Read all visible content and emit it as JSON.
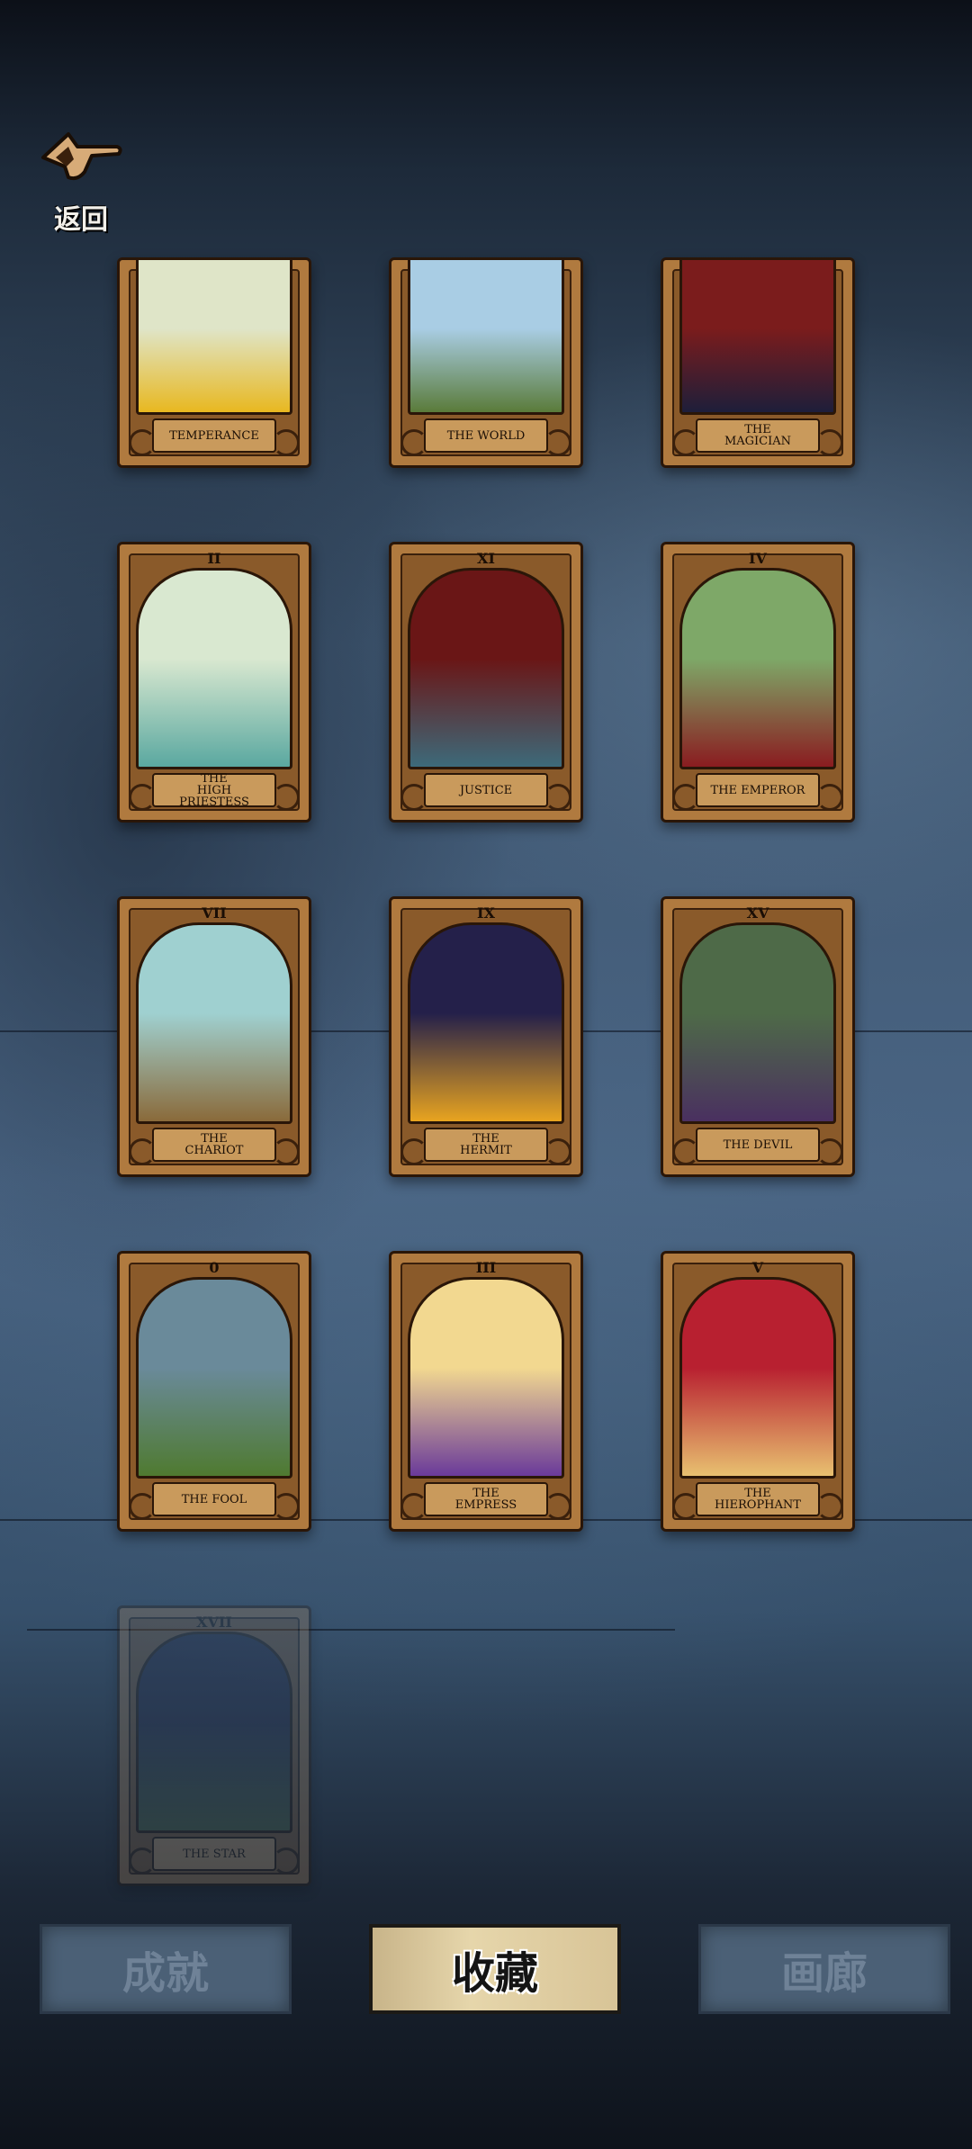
{
  "header": {
    "back_label": "返回"
  },
  "cards": [
    {
      "numeral": "",
      "name": "TEMPERANCE",
      "unlocked": true,
      "cropped": true,
      "art_colors": [
        "#dfe5c8",
        "#e8b820"
      ]
    },
    {
      "numeral": "",
      "name": "THE WORLD",
      "unlocked": true,
      "cropped": true,
      "art_colors": [
        "#a9cde4",
        "#5a7b3a"
      ]
    },
    {
      "numeral": "",
      "name": "THE\nMAGICIAN",
      "unlocked": true,
      "cropped": true,
      "art_colors": [
        "#7b1c1c",
        "#1e1e3a"
      ]
    },
    {
      "numeral": "II",
      "name": "THE\nHIGH\nPRIESTESS",
      "unlocked": true,
      "cropped": false,
      "art_colors": [
        "#d9e8d0",
        "#5aa8a0"
      ]
    },
    {
      "numeral": "XI",
      "name": "JUSTICE",
      "unlocked": true,
      "cropped": false,
      "art_colors": [
        "#6a1616",
        "#3d6a7a"
      ]
    },
    {
      "numeral": "IV",
      "name": "THE EMPEROR",
      "unlocked": true,
      "cropped": false,
      "art_colors": [
        "#7ea868",
        "#8a1c20"
      ]
    },
    {
      "numeral": "VII",
      "name": "THE\nCHARIOT",
      "unlocked": true,
      "cropped": false,
      "art_colors": [
        "#9fd0d0",
        "#8a6a3a"
      ]
    },
    {
      "numeral": "IX",
      "name": "THE\nHERMIT",
      "unlocked": true,
      "cropped": false,
      "art_colors": [
        "#24204a",
        "#e8a420"
      ]
    },
    {
      "numeral": "XV",
      "name": "THE DEVIL",
      "unlocked": true,
      "cropped": false,
      "art_colors": [
        "#4e6a48",
        "#4a3060"
      ]
    },
    {
      "numeral": "0",
      "name": "THE FOOL",
      "unlocked": true,
      "cropped": false,
      "art_colors": [
        "#6a8a9a",
        "#4f7a30"
      ]
    },
    {
      "numeral": "III",
      "name": "THE\nEMPRESS",
      "unlocked": true,
      "cropped": false,
      "art_colors": [
        "#f2d890",
        "#6a3a9a"
      ]
    },
    {
      "numeral": "V",
      "name": "THE\nHIEROPHANT",
      "unlocked": true,
      "cropped": false,
      "art_colors": [
        "#b82030",
        "#e8c070"
      ]
    },
    {
      "numeral": "XVII",
      "name": "THE STAR",
      "unlocked": false,
      "cropped": false,
      "art_colors": [
        "#1e2a5a",
        "#3a6a3a"
      ]
    }
  ],
  "tabs": [
    {
      "label": "成就",
      "active": false
    },
    {
      "label": "收藏",
      "active": true
    },
    {
      "label": "画廊",
      "active": false
    }
  ]
}
